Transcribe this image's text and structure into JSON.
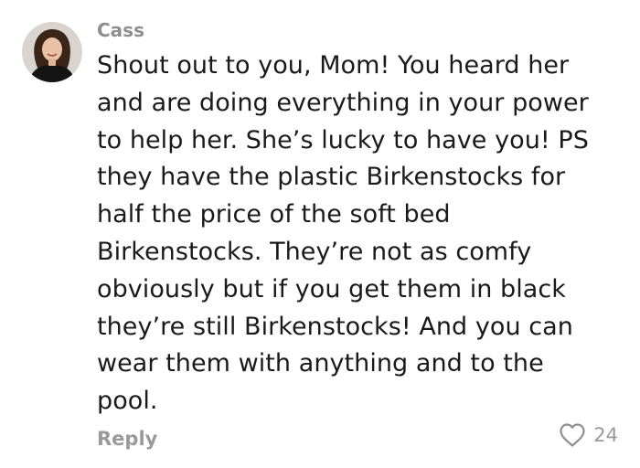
{
  "comment": {
    "author": "Cass",
    "avatar_icon": "user-avatar-photo",
    "lines": [
      "Shout out to you, Mom! You heard her",
      "and are doing everything in your power",
      "to help her. She’s lucky to have you! PS",
      "they have the plastic Birkenstocks for",
      "half the price of the soft bed",
      "Birkenstocks. They’re not as comfy",
      "obviously but if you get them in black",
      "they’re still Birkenstocks! And you can",
      "wear them with anything and to the",
      "pool."
    ],
    "reply_label": "Reply",
    "like_icon": "heart-outline-icon",
    "like_count": "24"
  },
  "colors": {
    "author": "#8e8e8e",
    "text": "#1a1a1a",
    "muted": "#9a9a9a"
  }
}
